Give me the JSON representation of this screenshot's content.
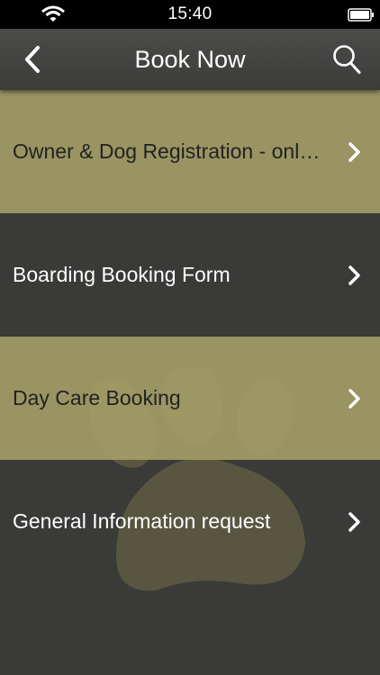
{
  "status_bar": {
    "time": "15:40"
  },
  "nav": {
    "title": "Book Now",
    "back_icon": "back-chevron",
    "search_icon": "magnifier"
  },
  "menu": {
    "items": [
      {
        "label": "Owner & Dog Registration - only…",
        "style": "light"
      },
      {
        "label": "Boarding Booking Form",
        "style": "dark"
      },
      {
        "label": "Day Care Booking",
        "style": "light"
      },
      {
        "label": "General Information request",
        "style": "dark"
      }
    ]
  },
  "colors": {
    "light_row": "#a6a168",
    "dark_bg": "#3a3a38",
    "nav_bg": "#444442"
  }
}
